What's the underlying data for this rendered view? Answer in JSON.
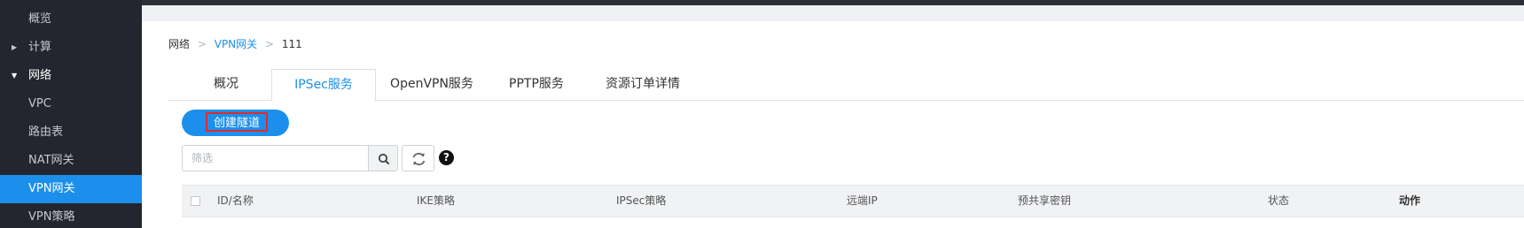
{
  "sidebar": {
    "items": [
      {
        "label": "概览"
      },
      {
        "label": "计算"
      },
      {
        "label": "网络"
      },
      {
        "label": "VPC"
      },
      {
        "label": "路由表"
      },
      {
        "label": "NAT网关"
      },
      {
        "label": "VPN网关"
      },
      {
        "label": "VPN策略"
      }
    ]
  },
  "breadcrumb": {
    "items": [
      "网络",
      "VPN网关",
      "111"
    ],
    "separator": ">"
  },
  "tabs": [
    {
      "label": "概况"
    },
    {
      "label": "IPSec服务"
    },
    {
      "label": "OpenVPN服务"
    },
    {
      "label": "PPTP服务"
    },
    {
      "label": "资源订单详情"
    }
  ],
  "active_tab": "IPSec服务",
  "actions": {
    "create_tunnel": "创建隧道"
  },
  "filter": {
    "placeholder": "筛选",
    "value": ""
  },
  "icons": {
    "search": "search-icon",
    "refresh": "refresh-icon",
    "help": "help-icon"
  },
  "help_glyph": "?",
  "table": {
    "columns": [
      "ID/名称",
      "IKE策略",
      "IPSec策略",
      "远端IP",
      "预共享密钥",
      "状态",
      "动作"
    ]
  },
  "colors": {
    "accent": "#1c8fec",
    "sidebar_bg": "#23262e",
    "highlight_border": "#e02b2b"
  }
}
